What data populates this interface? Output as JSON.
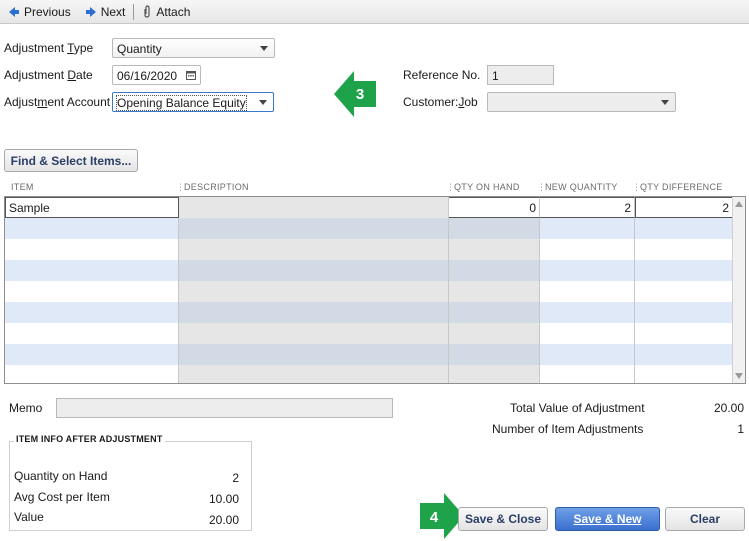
{
  "toolbar": {
    "previous_label": "Previous",
    "next_label": "Next",
    "attach_label": "Attach"
  },
  "form": {
    "adjustment_type": {
      "label_pre": "Adjustment ",
      "label_ul": "T",
      "label_post": "ype",
      "value": "Quantity"
    },
    "adjustment_date": {
      "label_pre": "Adjustment ",
      "label_ul": "D",
      "label_post": "ate",
      "value": "06/16/2020"
    },
    "adjustment_account": {
      "label_pre": "Adjust",
      "label_ul": "m",
      "label_post": "ent Account",
      "value": "Opening Balance Equity"
    },
    "reference_no": {
      "label": "Reference No.",
      "value": "1"
    },
    "customer_job": {
      "label_pre": "Customer:",
      "label_ul": "J",
      "label_post": "ob",
      "value": ""
    }
  },
  "find_select_button": "Find & Select Items...",
  "grid": {
    "headers": [
      "ITEM",
      "DESCRIPTION",
      "QTY ON HAND",
      "NEW QUANTITY",
      "QTY DIFFERENCE"
    ],
    "rows": [
      {
        "item": "Sample",
        "description": "",
        "qty_on_hand": "0",
        "new_quantity": "2",
        "qty_difference": "2"
      }
    ],
    "empty_rows": 8
  },
  "memo": {
    "label": "Memo",
    "value": ""
  },
  "totals": {
    "total_value_label": "Total Value of Adjustment",
    "total_value": "20.00",
    "num_adjustments_label": "Number of Item Adjustments",
    "num_adjustments": "1"
  },
  "item_info": {
    "title": "ITEM INFO AFTER ADJUSTMENT",
    "qty_on_hand_label": "Quantity on Hand",
    "qty_on_hand": "2",
    "avg_cost_label": "Avg Cost per Item",
    "avg_cost": "10.00",
    "value_label": "Value",
    "value": "20.00"
  },
  "buttons": {
    "save_close": "Save & Close",
    "save_new": "Save & New",
    "clear": "Clear"
  },
  "callouts": {
    "step3": "3",
    "step4": "4",
    "color": "#1fa34a"
  },
  "colors": {
    "row_alt": "#dfe9f7",
    "shaded_col": "#e6e6e6",
    "accent_blue": "#3a6fd0"
  }
}
